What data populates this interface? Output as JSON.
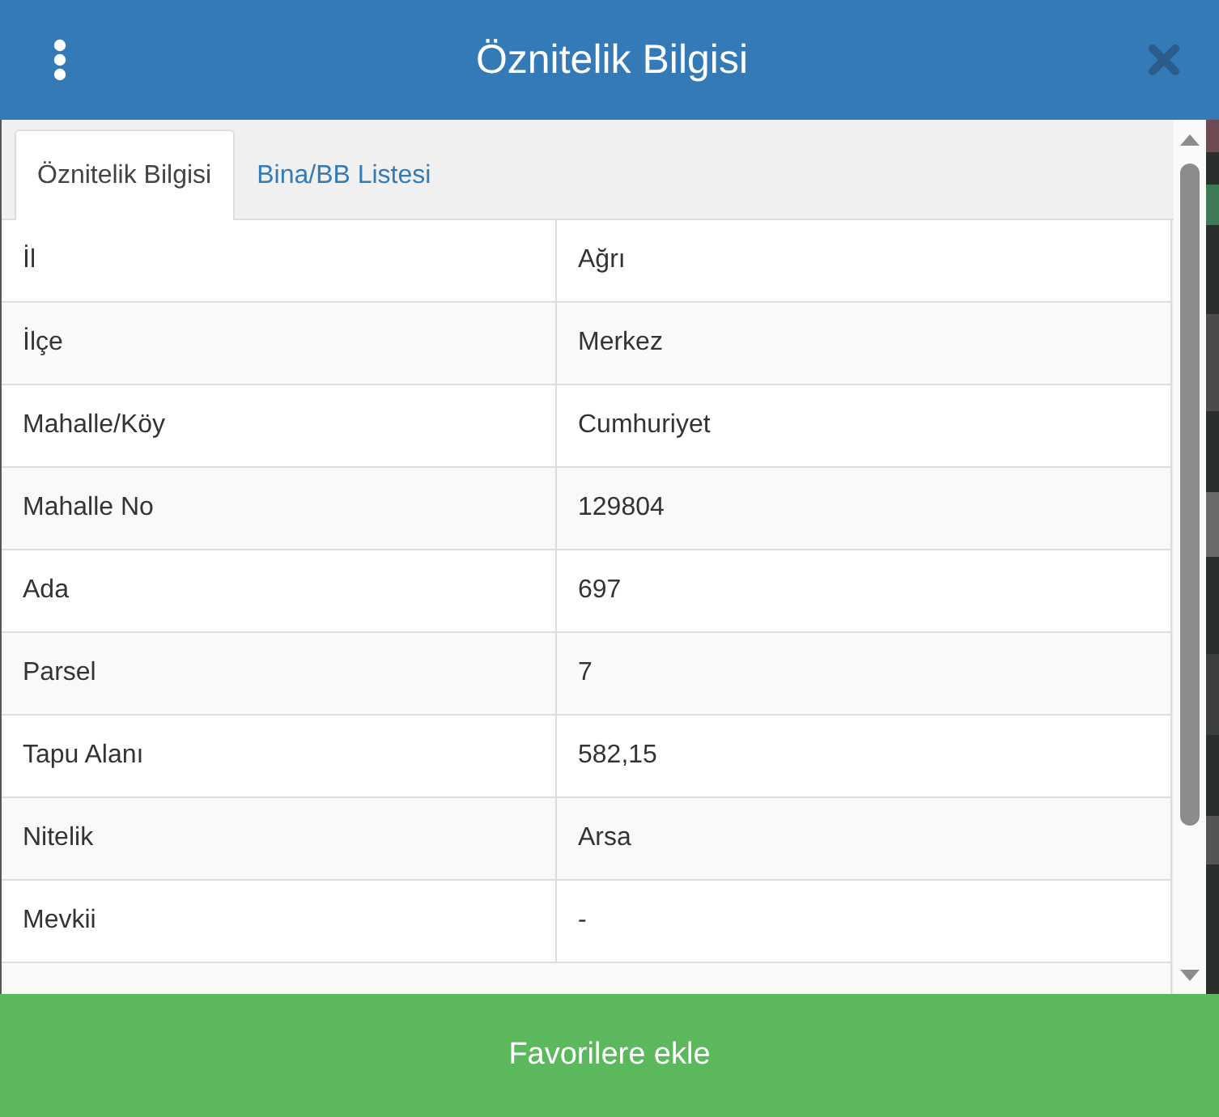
{
  "window": {
    "title": "Öznitelik Bilgisi"
  },
  "tabs": [
    {
      "label": "Öznitelik Bilgisi",
      "selected": true
    },
    {
      "label": "Bina/BB Listesi",
      "selected": false
    }
  ],
  "table": {
    "rows": [
      {
        "field": "İl",
        "value": "Ağrı"
      },
      {
        "field": "İlçe",
        "value": "Merkez"
      },
      {
        "field": "Mahalle/Köy",
        "value": "Cumhuriyet"
      },
      {
        "field": "Mahalle No",
        "value": "129804"
      },
      {
        "field": "Ada",
        "value": "697"
      },
      {
        "field": "Parsel",
        "value": "7"
      },
      {
        "field": "Tapu Alanı",
        "value": "582,15"
      },
      {
        "field": "Nitelik",
        "value": "Arsa"
      },
      {
        "field": "Mevkii",
        "value": "-"
      }
    ]
  },
  "footer_button": {
    "label": "Favorilere ekle"
  }
}
